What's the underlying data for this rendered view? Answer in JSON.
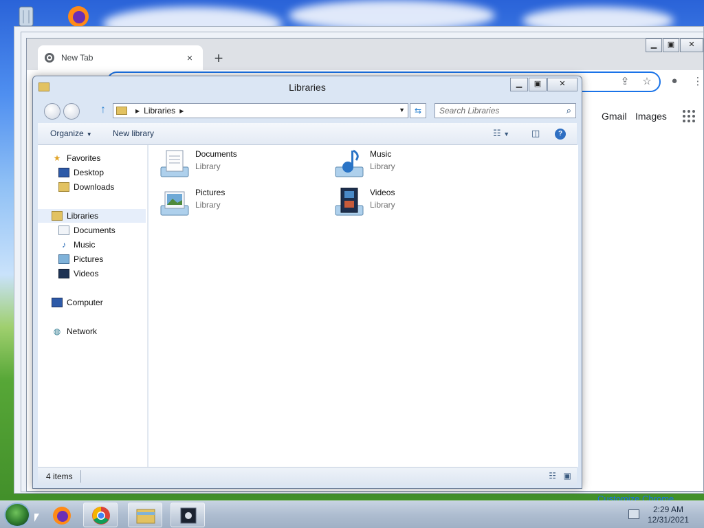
{
  "chrome": {
    "tab_title": "New Tab",
    "tab_close": "×",
    "new_tab": "+",
    "links": {
      "gmail": "Gmail",
      "images": "Images"
    },
    "customize": "Customize Chrome"
  },
  "explorer": {
    "title": "Libraries",
    "breadcrumb": [
      "Libraries"
    ],
    "search_placeholder": "Search Libraries",
    "toolbar": {
      "organize": "Organize",
      "new_library": "New library"
    },
    "nav": {
      "favorites": "Favorites",
      "desktop": "Desktop",
      "downloads": "Downloads",
      "libraries": "Libraries",
      "documents": "Documents",
      "music": "Music",
      "pictures": "Pictures",
      "videos": "Videos",
      "computer": "Computer",
      "network": "Network"
    },
    "items": [
      {
        "name": "Documents",
        "type": "Library"
      },
      {
        "name": "Music",
        "type": "Library"
      },
      {
        "name": "Pictures",
        "type": "Library"
      },
      {
        "name": "Videos",
        "type": "Library"
      }
    ],
    "status": "4 items"
  },
  "taskbar": {
    "time": "2:29 AM",
    "date": "12/31/2021"
  }
}
